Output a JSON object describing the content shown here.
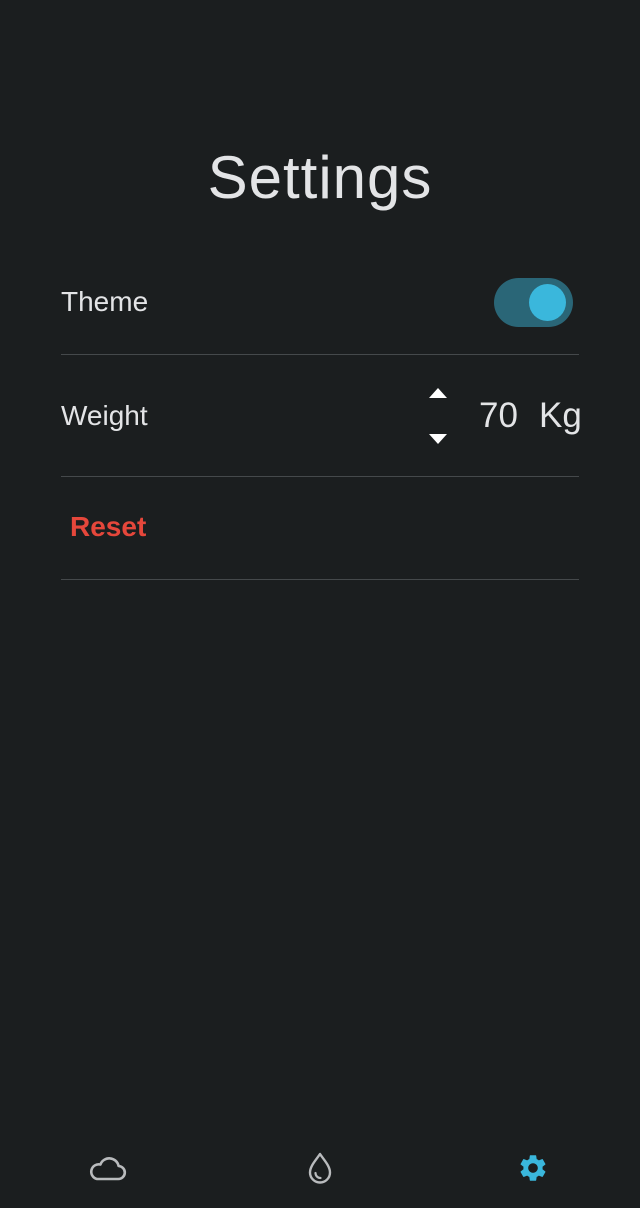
{
  "header": {
    "title": "Settings"
  },
  "settings": {
    "theme": {
      "label": "Theme",
      "enabled": true
    },
    "weight": {
      "label": "Weight",
      "value": "70",
      "unit": "Kg"
    },
    "reset": {
      "label": "Reset"
    }
  },
  "bottom_nav": {
    "items": [
      {
        "icon": "cloud-icon",
        "active": false
      },
      {
        "icon": "water-drop-icon",
        "active": false
      },
      {
        "icon": "gear-icon",
        "active": true
      }
    ]
  },
  "colors": {
    "background": "#1b1e1f",
    "accent": "#3ab7dc",
    "toggle_track": "#2a6677",
    "danger": "#e5473b",
    "inactive_icon": "#b9bbbd",
    "text": "#e3e4e6",
    "divider": "#45494b"
  }
}
